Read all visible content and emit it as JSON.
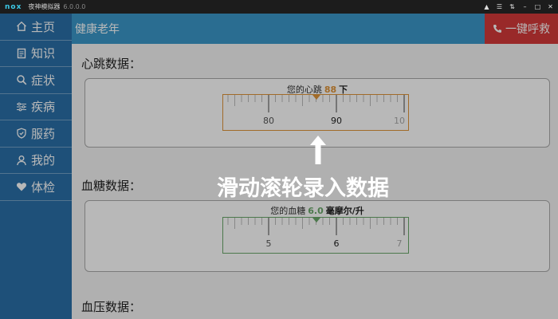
{
  "emulator": {
    "logo": "nox",
    "app_name": "夜神模拟器",
    "version": "6.0.0.0"
  },
  "sidebar": {
    "items": [
      {
        "label": "主页",
        "icon": "home-icon"
      },
      {
        "label": "知识",
        "icon": "document-icon"
      },
      {
        "label": "症状",
        "icon": "search-icon"
      },
      {
        "label": "疾病",
        "icon": "sliders-icon"
      },
      {
        "label": "服药",
        "icon": "shield-icon"
      },
      {
        "label": "我的",
        "icon": "user-icon"
      },
      {
        "label": "体检",
        "icon": "heart-icon"
      }
    ]
  },
  "header": {
    "title": "健康老年",
    "emergency_label": "一键呼救"
  },
  "heartbeat": {
    "section_title": "心跳数据：",
    "prefix": "您的心跳",
    "value": "88",
    "unit": "下",
    "value_color": "#e0953a",
    "ruler_color": "#e0953a",
    "ruler_labels": [
      "80",
      "90",
      "10"
    ]
  },
  "blood_sugar": {
    "section_title": "血糖数据：",
    "prefix": "您的血糖",
    "value": "6.0",
    "unit": "毫摩尔/升",
    "value_color": "#6aa86a",
    "ruler_color": "#6aa86a",
    "ruler_labels": [
      "5",
      "6",
      "7"
    ]
  },
  "blood_pressure": {
    "section_title": "血压数据："
  },
  "overlay": {
    "hint": "滑动滚轮录入数据"
  },
  "colors": {
    "sidebar": "#2a6fa8",
    "header": "#3b97c9",
    "emergency": "#d43a3a"
  }
}
